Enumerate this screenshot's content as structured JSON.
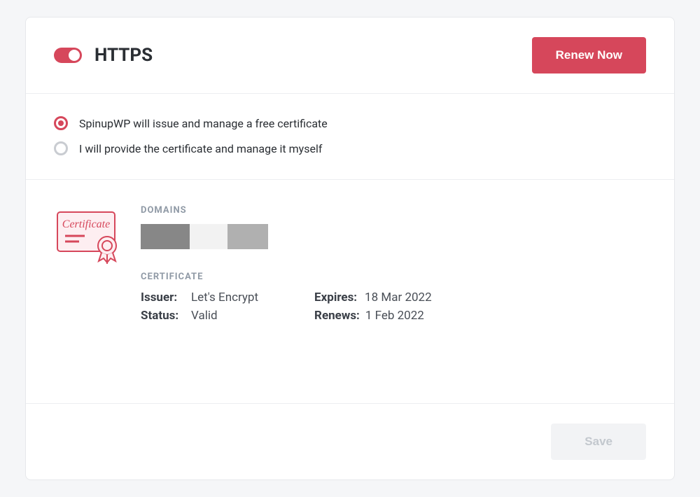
{
  "header": {
    "title": "HTTPS",
    "toggle_on": true,
    "renew_label": "Renew Now"
  },
  "options": {
    "auto_label": "SpinupWP will issue and manage a free certificate",
    "manual_label": "I will provide the certificate and manage it myself",
    "selected": "auto"
  },
  "domains": {
    "section_label": "DOMAINS"
  },
  "certificate": {
    "section_label": "CERTIFICATE",
    "issuer_key": "Issuer:",
    "issuer_value": "Let's Encrypt",
    "status_key": "Status:",
    "status_value": "Valid",
    "expires_key": "Expires:",
    "expires_value": "18 Mar 2022",
    "renews_key": "Renews:",
    "renews_value": "1 Feb 2022"
  },
  "footer": {
    "save_label": "Save"
  },
  "colors": {
    "accent": "#d6475b"
  }
}
